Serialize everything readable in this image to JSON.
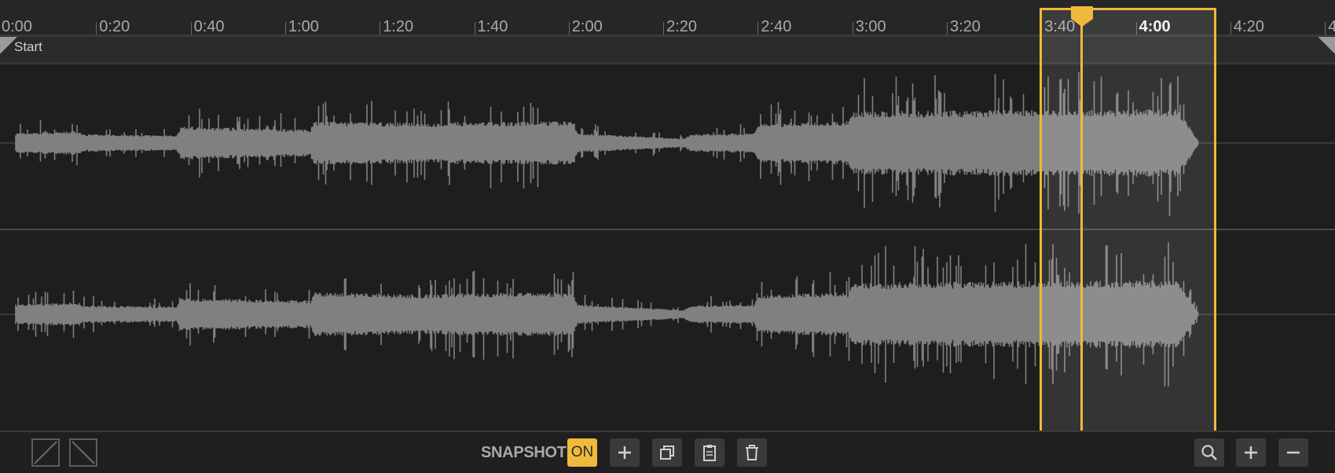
{
  "timeline": {
    "ticks": [
      "0:00",
      "0:20",
      "0:40",
      "1:00",
      "1:20",
      "1:40",
      "2:00",
      "2:20",
      "2:40",
      "3:00",
      "3:20",
      "3:40",
      "4:00",
      "4:20",
      "4:"
    ],
    "highlighted_tick": "4:00"
  },
  "markers": {
    "start_label": "Start"
  },
  "waveform": {
    "channels": 2,
    "color": "#808080",
    "selection_start": "3:40",
    "selection_end": "4:20",
    "playhead": "3:40"
  },
  "colors": {
    "accent": "#f0b93c",
    "background": "#1e1e1e",
    "wave": "#808080"
  },
  "toolbar": {
    "fade_in_icon": "fade-in-icon",
    "fade_out_icon": "fade-out-icon",
    "snapshot_label": "SNAPSHOT",
    "snapshot_toggle": "ON",
    "add_icon": "plus-icon",
    "copy_icon": "copy-icon",
    "paste_icon": "clipboard-icon",
    "delete_icon": "trash-icon",
    "zoom_icon": "magnifier-icon",
    "zoom_in_icon": "plus-icon",
    "zoom_out_icon": "minus-icon"
  }
}
